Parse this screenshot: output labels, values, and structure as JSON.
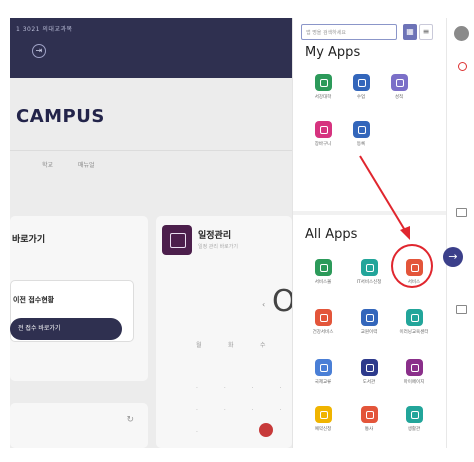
{
  "background": {
    "hero_subtitle": "1 3021 의대교과목",
    "campus_title": "CAMPUS",
    "tabs": [
      "학교",
      "매뉴얼"
    ],
    "card_left_title": "바로가기",
    "card_left_inner_title": "이전 접수현황",
    "card_left_button": "전 접수 바로가기",
    "schedule_title": "일정관리",
    "schedule_sub": "일정 관리 바로가기",
    "calendar_big_glyph": "O",
    "calendar_headers": [
      "월",
      "화",
      "수"
    ]
  },
  "panel": {
    "search_placeholder": "앱 명을 검색하세요",
    "my_apps_title": "My Apps",
    "all_apps_title": "All Apps",
    "my_apps": [
      {
        "label": "서강대학",
        "color": "#2c9a5a",
        "icon": "bulb-icon"
      },
      {
        "label": "수업",
        "color": "#3366bb",
        "icon": "cap-icon"
      },
      {
        "label": "성적",
        "color": "#7b6fc8",
        "icon": "grade-icon"
      },
      {
        "label": "장바구니",
        "color": "#d6337f",
        "icon": "link-icon"
      },
      {
        "label": "등록",
        "color": "#3366bb",
        "icon": "cap-icon"
      }
    ],
    "all_apps": [
      {
        "label": "서비스몰",
        "color": "#2c9a5a",
        "icon": "building-icon"
      },
      {
        "label": "IT서비스신청",
        "color": "#22a59a",
        "icon": "monitor-icon"
      },
      {
        "label": "서비스",
        "color": "#e3553a",
        "icon": "edit-icon"
      },
      {
        "label": "건강서비스",
        "color": "#e3553a",
        "icon": "mouse-icon"
      },
      {
        "label": "교원이력",
        "color": "#3366bb",
        "icon": "cap-icon"
      },
      {
        "label": "이러닝교육센터",
        "color": "#22a59a",
        "icon": "screen-icon"
      },
      {
        "label": "국제교류",
        "color": "#4a7fd6",
        "icon": "globe-icon"
      },
      {
        "label": "도서관",
        "color": "#2d3a8c",
        "icon": "book-icon"
      },
      {
        "label": "마이페이지",
        "color": "#8a2f8a",
        "icon": "user-icon"
      },
      {
        "label": "예약신청",
        "color": "#f0b400",
        "icon": "calendar-icon"
      },
      {
        "label": "통사",
        "color": "#e3553a",
        "icon": "bus-icon"
      },
      {
        "label": "생활관",
        "color": "#22a59a",
        "icon": "clock-icon"
      }
    ]
  }
}
